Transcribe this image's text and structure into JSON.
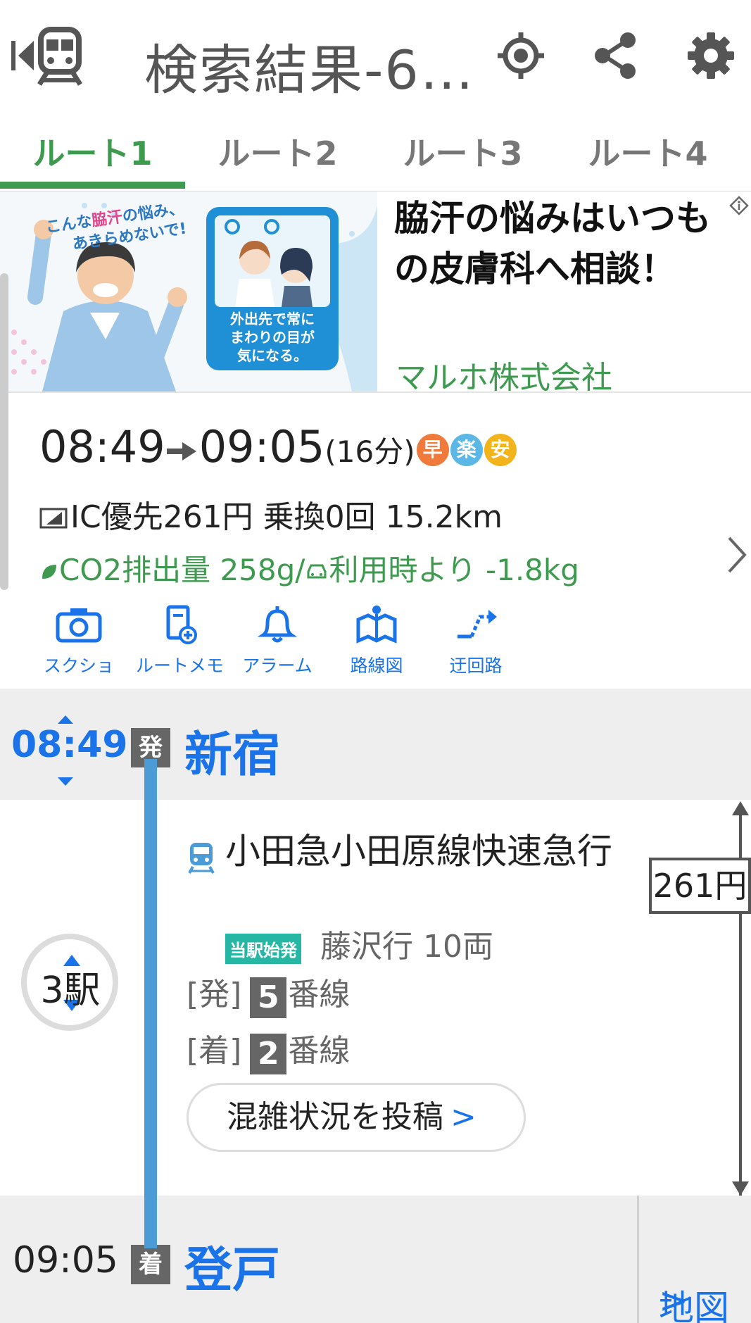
{
  "header": {
    "title": "検索結果-6…",
    "icons": [
      "back-train-icon",
      "location-icon",
      "share-icon",
      "gear-icon"
    ]
  },
  "tabs": [
    {
      "label": "ルート1",
      "active": true
    },
    {
      "label": "ルート2",
      "active": false
    },
    {
      "label": "ルート3",
      "active": false
    },
    {
      "label": "ルート4",
      "active": false
    }
  ],
  "ad": {
    "image_bubble": "こんな脇汗の悩み、あきらめないで!",
    "image_caption": "外出先で常にまわりの目が気になる。",
    "headline": "脇汗の悩みはいつもの皮膚科へ相談！",
    "advertiser": "マルホ株式会社"
  },
  "summary": {
    "dep_time": "08:49",
    "arr_time": "09:05",
    "duration": "(16分)",
    "badges": [
      {
        "label": "早",
        "color": "#f07a3c"
      },
      {
        "label": "楽",
        "color": "#5bb7e6"
      },
      {
        "label": "安",
        "color": "#f3b41b"
      }
    ],
    "fare_line": "IC優先261円 乗換0回 15.2km",
    "co2_line": "CO2排出量 258g/",
    "co2_saving": "利用時より -1.8kg"
  },
  "actions": [
    {
      "label": "スクショ",
      "icon": "camera-icon"
    },
    {
      "label": "ルートメモ",
      "icon": "memo-add-icon"
    },
    {
      "label": "アラーム",
      "icon": "bell-icon"
    },
    {
      "label": "路線図",
      "icon": "map-pin-icon"
    },
    {
      "label": "迂回路",
      "icon": "detour-icon"
    }
  ],
  "route": {
    "departure": {
      "time": "08:49",
      "tag": "発",
      "station": "新宿"
    },
    "segment": {
      "line_name": "小田急小田原線快速急行",
      "start_badge": "当駅始発",
      "destination": "藤沢行 10両",
      "dep_platform_label": "[発]",
      "dep_platform_num": "5",
      "arr_platform_label": "[着]",
      "arr_platform_num": "2",
      "platform_suffix": "番線",
      "stops": "3駅",
      "fare": "261円",
      "congestion_button": "混雑状況を投稿"
    },
    "arrival": {
      "time": "09:05",
      "tag": "着",
      "station": "登戸",
      "map_link": "地図"
    }
  },
  "colors": {
    "accent_green": "#3d9a4e",
    "link_blue": "#1a73e8",
    "line_blue": "#4a9bd6",
    "start_badge_teal": "#25b6a4"
  }
}
